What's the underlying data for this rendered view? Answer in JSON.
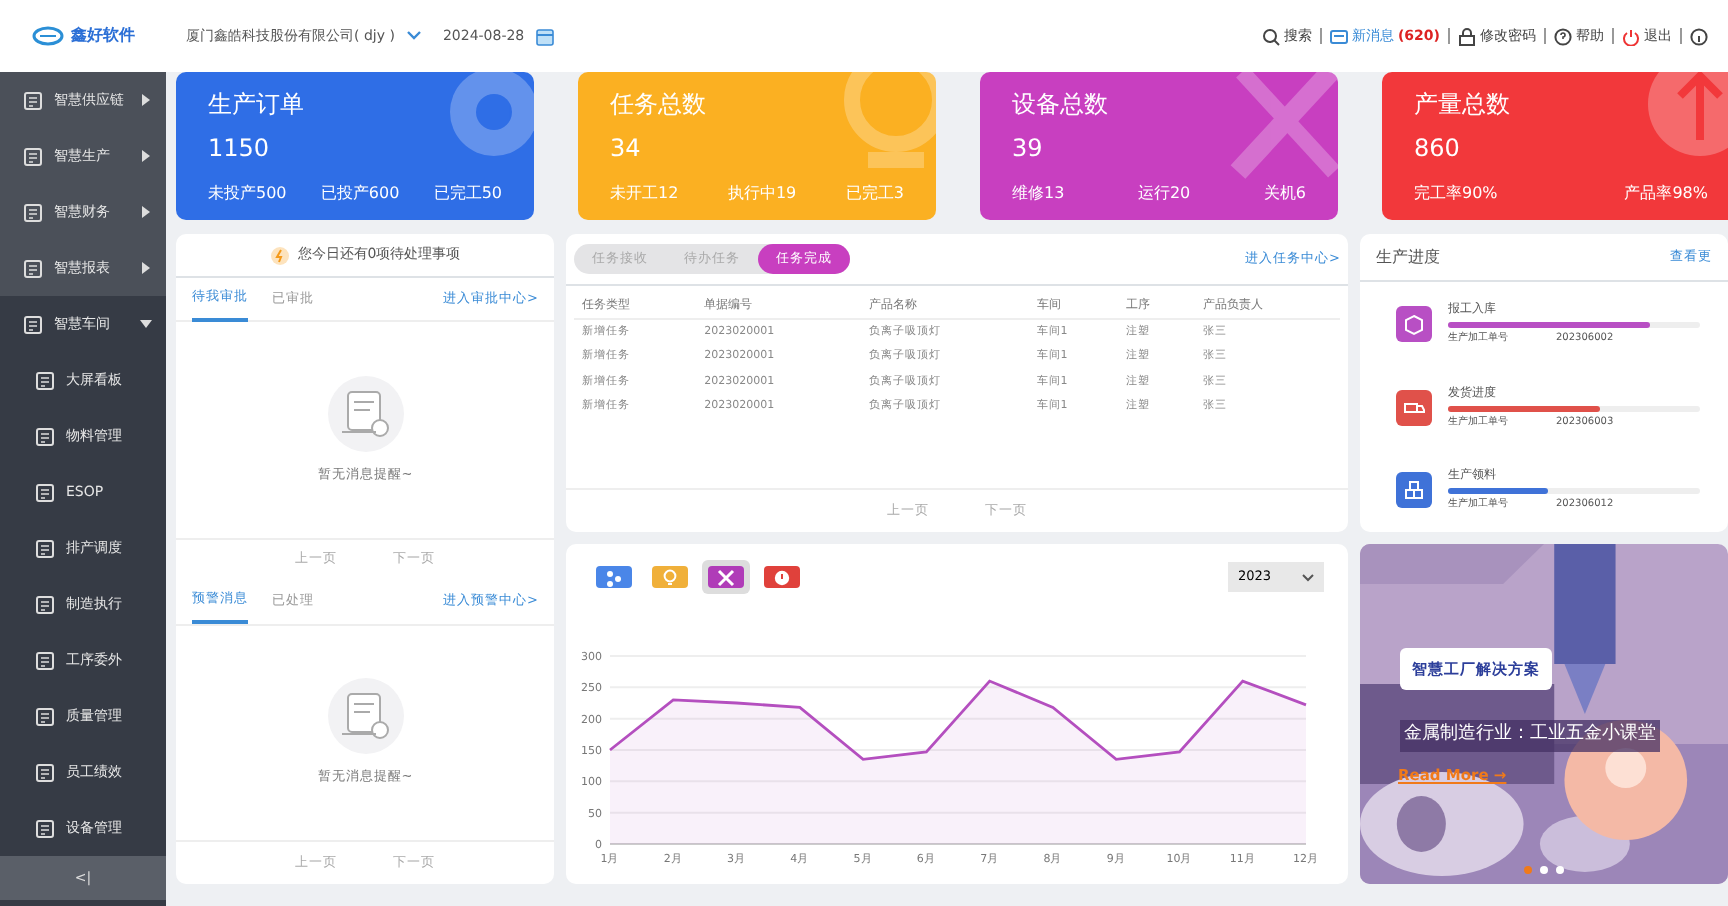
{
  "header": {
    "logo": "鑫好软件",
    "company": "厦门鑫皓科技股份有限公司( djy )",
    "date": "2024-08-28",
    "actions": [
      {
        "kind": "search",
        "label": "搜索"
      },
      {
        "kind": "message",
        "label": "新消息",
        "count": "(620)"
      },
      {
        "kind": "lock",
        "label": "修改密码"
      },
      {
        "kind": "help",
        "label": "帮助"
      },
      {
        "kind": "power",
        "label": "退出"
      },
      {
        "kind": "info"
      }
    ]
  },
  "sidebar": {
    "items": [
      {
        "label": "智慧供应链",
        "expanded": false
      },
      {
        "label": "智慧生产",
        "expanded": false
      },
      {
        "label": "智慧财务",
        "expanded": false
      },
      {
        "label": "智慧报表",
        "expanded": false
      },
      {
        "label": "智慧车间",
        "expanded": true,
        "children": [
          {
            "label": "大屏看板"
          },
          {
            "label": "物料管理"
          },
          {
            "label": "ESOP"
          },
          {
            "label": "排产调度"
          },
          {
            "label": "制造执行"
          },
          {
            "label": "工序委外"
          },
          {
            "label": "质量管理"
          },
          {
            "label": "员工绩效"
          },
          {
            "label": "设备管理"
          }
        ]
      }
    ],
    "collapse": "<|"
  },
  "stat_cards": [
    {
      "kind": "gear",
      "color": "#2f6ee6",
      "title": "生产订单",
      "value": "1150",
      "stats": [
        "未投产500",
        "已投产600",
        "已完工50"
      ]
    },
    {
      "kind": "bulb",
      "color": "#fbb022",
      "title": "任务总数",
      "value": "34",
      "stats": [
        "未开工12",
        "执行中19",
        "已完工3"
      ]
    },
    {
      "kind": "wrench",
      "color": "#c83fc0",
      "title": "设备总数",
      "value": "39",
      "stats": [
        "维修13",
        "运行20",
        "关机6"
      ]
    },
    {
      "kind": "arrow",
      "color": "#f2383b",
      "title": "产量总数",
      "value": "860",
      "stats": [
        "完工率90%",
        "产品率98%"
      ]
    }
  ],
  "todo": {
    "notice": "您今日还有0项待处理事项",
    "sections": [
      {
        "tabs": [
          {
            "label": "待我审批",
            "selected": true
          },
          {
            "label": "已审批",
            "selected": false
          }
        ],
        "link": "进入审批中心>",
        "empty": "暂无消息提醒~",
        "pager": [
          "上一页",
          "下一页"
        ]
      },
      {
        "tabs": [
          {
            "label": "预警消息",
            "selected": true
          },
          {
            "label": "已处理",
            "selected": false
          }
        ],
        "link": "进入预警中心>",
        "empty": "暂无消息提醒~",
        "pager": [
          "上一页",
          "下一页"
        ]
      }
    ]
  },
  "tasks": {
    "tabs": [
      {
        "label": "任务接收",
        "selected": false
      },
      {
        "label": "待办任务",
        "selected": false
      },
      {
        "label": "任务完成",
        "selected": true
      }
    ],
    "link": "进入任务中心>",
    "table": {
      "columns": [
        "任务类型",
        "单据编号",
        "产品名称",
        "车间",
        "工序",
        "产品负责人"
      ],
      "rows": [
        [
          "新增任务",
          "2023020001",
          "负离子吸顶灯",
          "车间1",
          "注塑",
          "张三"
        ],
        [
          "新增任务",
          "2023020001",
          "负离子吸顶灯",
          "车间1",
          "注塑",
          "张三"
        ],
        [
          "新增任务",
          "2023020001",
          "负离子吸顶灯",
          "车间1",
          "注塑",
          "张三"
        ],
        [
          "新增任务",
          "2023020001",
          "负离子吸顶灯",
          "车间1",
          "注塑",
          "张三"
        ]
      ]
    },
    "pager": [
      "上一页",
      "下一页"
    ]
  },
  "progress": {
    "title": "生产进度",
    "link": "查看更",
    "items": [
      {
        "kind": "box",
        "color": "#b84fc4",
        "name": "报工入库",
        "level": 0.8,
        "label": "生产加工单号",
        "number": "202306002"
      },
      {
        "kind": "truck",
        "color": "#e0514a",
        "name": "发货进度",
        "level": 0.6,
        "label": "生产加工单号",
        "number": "202306003"
      },
      {
        "kind": "stack",
        "color": "#3f72d8",
        "name": "生产领料",
        "level": 0.4,
        "label": "生产加工单号",
        "number": "202306012"
      }
    ]
  },
  "chart_panel": {
    "buttons": [
      {
        "kind": "network",
        "color": "#4a86e8",
        "selected": false
      },
      {
        "kind": "bulb",
        "color": "#f0b03a",
        "selected": false
      },
      {
        "kind": "tools",
        "color": "#b03cb8",
        "selected": true
      },
      {
        "kind": "alert",
        "color": "#e0413b",
        "selected": false
      }
    ],
    "year": "2023",
    "chart_data": {
      "type": "area",
      "grid": true,
      "categories": [
        "1月",
        "2月",
        "3月",
        "4月",
        "5月",
        "6月",
        "7月",
        "8月",
        "9月",
        "10月",
        "11月",
        "12月"
      ],
      "ylim": [
        0,
        300
      ],
      "yticks": [
        0,
        50,
        100,
        150,
        200,
        250,
        300
      ],
      "series": [
        {
          "color": "#b44fbf",
          "values": [
            150,
            230,
            225,
            218,
            135,
            147,
            260,
            218,
            135,
            147,
            260,
            222
          ]
        }
      ]
    }
  },
  "banner": {
    "kind": "picture",
    "badge": "智慧工厂解决方案",
    "headline": "金属制造行业：工业五金小课堂",
    "more": "Read More →",
    "slides": [
      {
        "selected": true
      },
      {
        "selected": false
      },
      {
        "selected": false
      }
    ]
  }
}
